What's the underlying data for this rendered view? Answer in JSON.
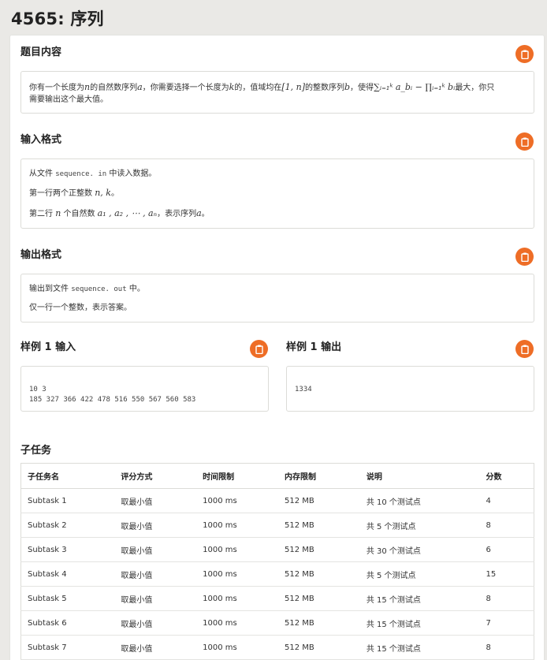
{
  "page": {
    "title": "4565: 序列"
  },
  "sections": {
    "description": {
      "title": "题目内容",
      "line1_a": "你有一个长度为",
      "line1_n": "n",
      "line1_b": "的自然数序列",
      "line1_seq": "a",
      "line1_c": "，你需要选择一个长度为",
      "line1_k": "k",
      "line1_d": "的，值域均在",
      "line1_range": "[1, n]",
      "line1_e": "的整数序列",
      "line1_b_var": "b",
      "line1_f": "，使得",
      "line1_formula": "∑ᵢ₌₁ᵏ a_bᵢ − ∏ᵢ₌₁ᵏ bᵢ",
      "line1_g": "最大，你只",
      "line2": "需要输出这个最大值。"
    },
    "input": {
      "title": "输入格式",
      "line1_a": "从文件",
      "line1_file": "sequence. in",
      "line1_b": "中读入数据。",
      "line2_a": "第一行两个正整数",
      "line2_math": "n, k",
      "line2_b": "。",
      "line3_a": "第二行",
      "line3_n": "n",
      "line3_b": "个自然数",
      "line3_math": "a₁ , a₂ , ⋯ , aₙ",
      "line3_c": "，表示序列",
      "line3_a_var": "a",
      "line3_d": "。"
    },
    "output": {
      "title": "输出格式",
      "line1_a": "输出到文件",
      "line1_file": "sequence. out",
      "line1_b": "中。",
      "line2": "仅一行一个整数，表示答案。"
    },
    "sample_input": {
      "title": "样例 1 输入",
      "content": "10 3\n185 327 366 422 478 516 550 567 560 583"
    },
    "sample_output": {
      "title": "样例 1 输出",
      "content": "1334"
    }
  },
  "subtasks": {
    "title": "子任务",
    "headers": [
      "子任务名",
      "评分方式",
      "时间限制",
      "内存限制",
      "说明",
      "分数"
    ],
    "rows": [
      [
        "Subtask 1",
        "取最小值",
        "1000 ms",
        "512 MB",
        "共 10 个测试点",
        "4"
      ],
      [
        "Subtask 2",
        "取最小值",
        "1000 ms",
        "512 MB",
        "共 5 个测试点",
        "8"
      ],
      [
        "Subtask 3",
        "取最小值",
        "1000 ms",
        "512 MB",
        "共 30 个测试点",
        "6"
      ],
      [
        "Subtask 4",
        "取最小值",
        "1000 ms",
        "512 MB",
        "共 5 个测试点",
        "15"
      ],
      [
        "Subtask 5",
        "取最小值",
        "1000 ms",
        "512 MB",
        "共 15 个测试点",
        "8"
      ],
      [
        "Subtask 6",
        "取最小值",
        "1000 ms",
        "512 MB",
        "共 15 个测试点",
        "7"
      ],
      [
        "Subtask 7",
        "取最小值",
        "1000 ms",
        "512 MB",
        "共 15 个测试点",
        "8"
      ]
    ]
  },
  "icons": {
    "copy": "clipboard-icon"
  },
  "colors": {
    "accent": "#ee6d26",
    "background": "#eae9e6"
  }
}
